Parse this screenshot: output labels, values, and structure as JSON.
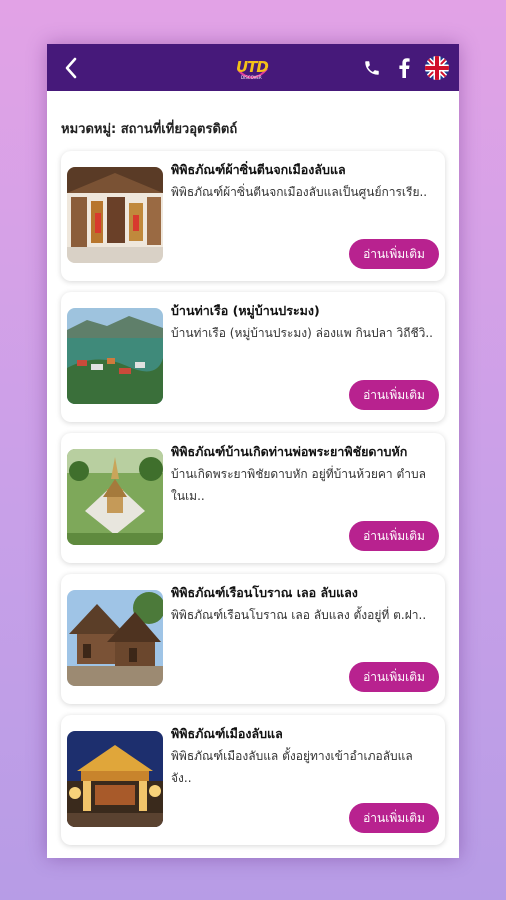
{
  "header": {
    "back_icon": "chevron-left-icon",
    "logo_text": "UTD",
    "logo_sub": "DISCOVER",
    "phone_icon": "phone-icon",
    "facebook_icon": "facebook-icon",
    "language_icon": "uk-flag-icon",
    "bar_color": "#46197a"
  },
  "category_label": "หมวดหมู่: สถานที่เที่ยวอุตรดิตถ์",
  "read_more_label": "อ่านเพิ่มเติม",
  "accent_color": "#b8228f",
  "places": [
    {
      "title": "พิพิธภัณฑ์ผ้าซิ่นตีนจกเมืองลับแล",
      "desc": "   พิพิธภัณฑ์ผ้าซิ่นตีนจกเมืองลับแลเป็นศูนย์การเรีย.."
    },
    {
      "title": "บ้านท่าเรือ (หมู่บ้านประมง)",
      "desc": "บ้านท่าเรือ (หมู่บ้านประมง) ล่องแพ กินปลา วิถีชีวิ.."
    },
    {
      "title": "พิพิธภัณฑ์บ้านเกิดท่านพ่อพระยาพิชัยดาบหัก",
      "desc": "บ้านเกิดพระยาพิชัยดาบหัก อยู่ที่บ้านห้วยคา ตำบลในเม.."
    },
    {
      "title": "พิพิธภัณฑ์เรือนโบราณ เลอ ลับแลง",
      "desc": "   พิพิธภัณฑ์เรือนโบราณ เลอ ลับแลง ตั้งอยู่ที่ ต.ฝา.."
    },
    {
      "title": "พิพิธภัณฑ์เมืองลับแล",
      "desc": "พิพิธภัณฑ์เมืองลับแล ตั้งอยู่ทางเข้าอำเภอลับแล จัง.."
    }
  ]
}
